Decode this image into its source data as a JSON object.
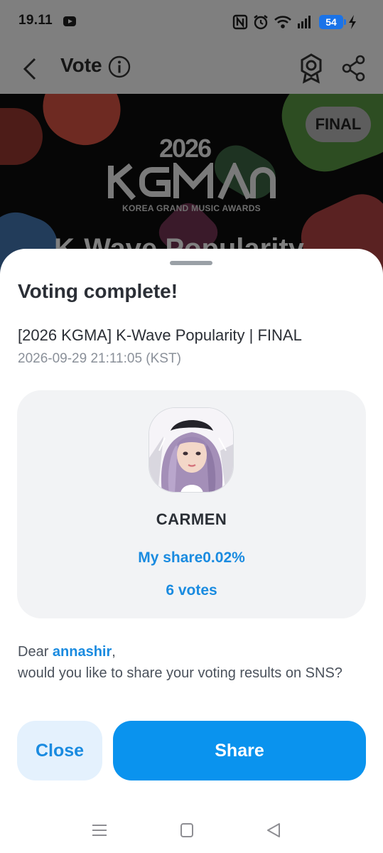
{
  "status_bar": {
    "time": "19.11",
    "battery": "54",
    "icons": [
      "youtube-icon",
      "nfc-icon",
      "alarm-icon",
      "wifi-icon",
      "signal-icon",
      "battery-icon",
      "charging-icon"
    ]
  },
  "app_bar": {
    "title": "Vote",
    "icons": [
      "back-icon",
      "info-icon",
      "award-icon",
      "share-icon"
    ]
  },
  "banner": {
    "badge": "FINAL",
    "year": "2026",
    "logo_text": "KGMA",
    "subtitle": "KOREA GRAND MUSIC AWARDS",
    "title": "K-Wave Popularity"
  },
  "sheet": {
    "title": "Voting complete!",
    "vote_name": "[2026 KGMA] K-Wave Popularity | FINAL",
    "vote_time": "2026-09-29 21:11:05 (KST)",
    "result": {
      "candidate": "CARMEN",
      "my_share": "My share0.02%",
      "votes": "6 votes"
    },
    "message": {
      "greeting": "Dear ",
      "username": "annashir",
      "comma": ",",
      "body": "would you like to share your voting results on SNS?"
    },
    "buttons": {
      "close": "Close",
      "share": "Share"
    }
  },
  "colors": {
    "accent": "#0a93ee",
    "accent_text": "#1a8be0",
    "close_bg": "#e4f1fd",
    "card_bg": "#f2f3f5",
    "overlay": "#7f7f7f"
  }
}
